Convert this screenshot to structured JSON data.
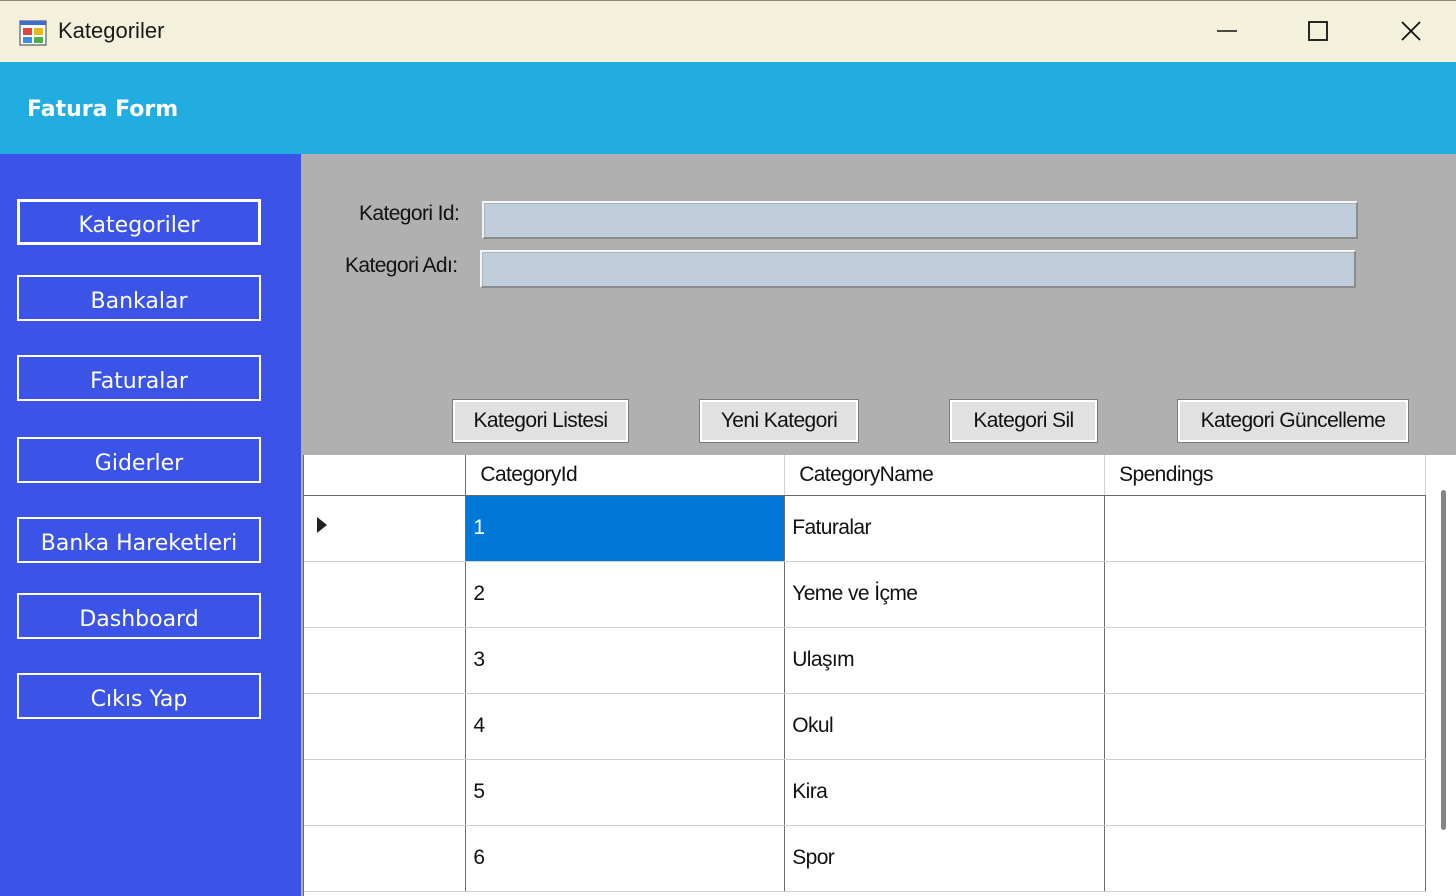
{
  "window": {
    "title": "Kategoriler",
    "app_icon": "winforms-app-icon",
    "controls": [
      "minimize-icon",
      "maximize-icon",
      "close-icon"
    ]
  },
  "header": {
    "title": "Fatura Form",
    "color": "#22ade0"
  },
  "sidebar": {
    "color": "#3b53e6",
    "items": [
      {
        "label": "Kategoriler",
        "active": true
      },
      {
        "label": "Bankalar"
      },
      {
        "label": "Faturalar"
      },
      {
        "label": "Giderler"
      },
      {
        "label": "Banka Hareketleri"
      },
      {
        "label": "Dashboard"
      },
      {
        "label": "Cıkıs Yap"
      }
    ]
  },
  "form": {
    "id_label": "Kategori Id:",
    "id_value": "",
    "name_label": "Kategori Adı:",
    "name_value": ""
  },
  "actions": {
    "list": "Kategori Listesi",
    "new": "Yeni Kategori",
    "delete": "Kategori Sil",
    "update": "Kategori Güncelleme"
  },
  "grid": {
    "columns": [
      "CategoryId",
      "CategoryName",
      "Spendings"
    ],
    "current_row_icon": "row-pointer-icon",
    "selection_color": "#0078d7",
    "rows": [
      {
        "id": "1",
        "name": "Faturalar",
        "spendings": ""
      },
      {
        "id": "2",
        "name": "Yeme ve İçme",
        "spendings": ""
      },
      {
        "id": "3",
        "name": "Ulaşım",
        "spendings": ""
      },
      {
        "id": "4",
        "name": "Okul",
        "spendings": ""
      },
      {
        "id": "5",
        "name": "Kira",
        "spendings": ""
      },
      {
        "id": "6",
        "name": "Spor",
        "spendings": ""
      }
    ]
  }
}
